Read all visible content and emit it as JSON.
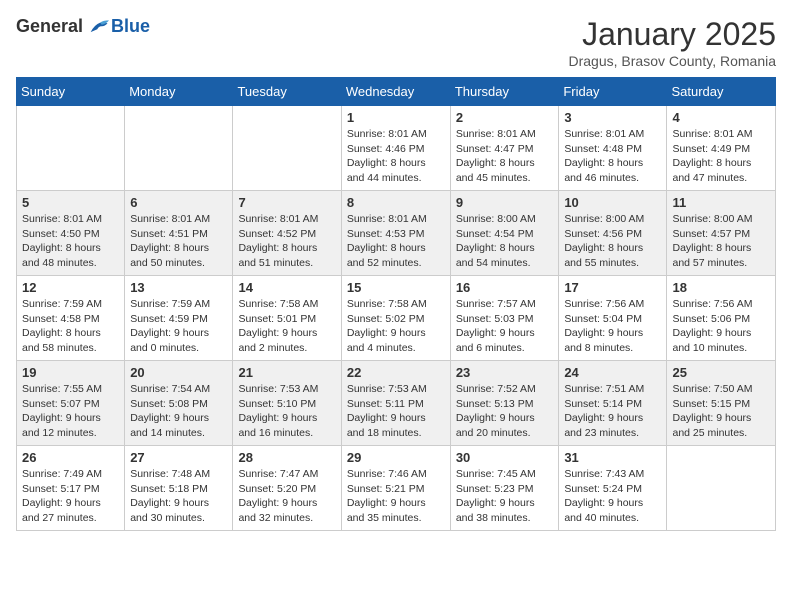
{
  "logo": {
    "general": "General",
    "blue": "Blue"
  },
  "title": {
    "month": "January 2025",
    "location": "Dragus, Brasov County, Romania"
  },
  "weekdays": [
    "Sunday",
    "Monday",
    "Tuesday",
    "Wednesday",
    "Thursday",
    "Friday",
    "Saturday"
  ],
  "weeks": [
    [
      {
        "day": "",
        "info": ""
      },
      {
        "day": "",
        "info": ""
      },
      {
        "day": "",
        "info": ""
      },
      {
        "day": "1",
        "info": "Sunrise: 8:01 AM\nSunset: 4:46 PM\nDaylight: 8 hours\nand 44 minutes."
      },
      {
        "day": "2",
        "info": "Sunrise: 8:01 AM\nSunset: 4:47 PM\nDaylight: 8 hours\nand 45 minutes."
      },
      {
        "day": "3",
        "info": "Sunrise: 8:01 AM\nSunset: 4:48 PM\nDaylight: 8 hours\nand 46 minutes."
      },
      {
        "day": "4",
        "info": "Sunrise: 8:01 AM\nSunset: 4:49 PM\nDaylight: 8 hours\nand 47 minutes."
      }
    ],
    [
      {
        "day": "5",
        "info": "Sunrise: 8:01 AM\nSunset: 4:50 PM\nDaylight: 8 hours\nand 48 minutes."
      },
      {
        "day": "6",
        "info": "Sunrise: 8:01 AM\nSunset: 4:51 PM\nDaylight: 8 hours\nand 50 minutes."
      },
      {
        "day": "7",
        "info": "Sunrise: 8:01 AM\nSunset: 4:52 PM\nDaylight: 8 hours\nand 51 minutes."
      },
      {
        "day": "8",
        "info": "Sunrise: 8:01 AM\nSunset: 4:53 PM\nDaylight: 8 hours\nand 52 minutes."
      },
      {
        "day": "9",
        "info": "Sunrise: 8:00 AM\nSunset: 4:54 PM\nDaylight: 8 hours\nand 54 minutes."
      },
      {
        "day": "10",
        "info": "Sunrise: 8:00 AM\nSunset: 4:56 PM\nDaylight: 8 hours\nand 55 minutes."
      },
      {
        "day": "11",
        "info": "Sunrise: 8:00 AM\nSunset: 4:57 PM\nDaylight: 8 hours\nand 57 minutes."
      }
    ],
    [
      {
        "day": "12",
        "info": "Sunrise: 7:59 AM\nSunset: 4:58 PM\nDaylight: 8 hours\nand 58 minutes."
      },
      {
        "day": "13",
        "info": "Sunrise: 7:59 AM\nSunset: 4:59 PM\nDaylight: 9 hours\nand 0 minutes."
      },
      {
        "day": "14",
        "info": "Sunrise: 7:58 AM\nSunset: 5:01 PM\nDaylight: 9 hours\nand 2 minutes."
      },
      {
        "day": "15",
        "info": "Sunrise: 7:58 AM\nSunset: 5:02 PM\nDaylight: 9 hours\nand 4 minutes."
      },
      {
        "day": "16",
        "info": "Sunrise: 7:57 AM\nSunset: 5:03 PM\nDaylight: 9 hours\nand 6 minutes."
      },
      {
        "day": "17",
        "info": "Sunrise: 7:56 AM\nSunset: 5:04 PM\nDaylight: 9 hours\nand 8 minutes."
      },
      {
        "day": "18",
        "info": "Sunrise: 7:56 AM\nSunset: 5:06 PM\nDaylight: 9 hours\nand 10 minutes."
      }
    ],
    [
      {
        "day": "19",
        "info": "Sunrise: 7:55 AM\nSunset: 5:07 PM\nDaylight: 9 hours\nand 12 minutes."
      },
      {
        "day": "20",
        "info": "Sunrise: 7:54 AM\nSunset: 5:08 PM\nDaylight: 9 hours\nand 14 minutes."
      },
      {
        "day": "21",
        "info": "Sunrise: 7:53 AM\nSunset: 5:10 PM\nDaylight: 9 hours\nand 16 minutes."
      },
      {
        "day": "22",
        "info": "Sunrise: 7:53 AM\nSunset: 5:11 PM\nDaylight: 9 hours\nand 18 minutes."
      },
      {
        "day": "23",
        "info": "Sunrise: 7:52 AM\nSunset: 5:13 PM\nDaylight: 9 hours\nand 20 minutes."
      },
      {
        "day": "24",
        "info": "Sunrise: 7:51 AM\nSunset: 5:14 PM\nDaylight: 9 hours\nand 23 minutes."
      },
      {
        "day": "25",
        "info": "Sunrise: 7:50 AM\nSunset: 5:15 PM\nDaylight: 9 hours\nand 25 minutes."
      }
    ],
    [
      {
        "day": "26",
        "info": "Sunrise: 7:49 AM\nSunset: 5:17 PM\nDaylight: 9 hours\nand 27 minutes."
      },
      {
        "day": "27",
        "info": "Sunrise: 7:48 AM\nSunset: 5:18 PM\nDaylight: 9 hours\nand 30 minutes."
      },
      {
        "day": "28",
        "info": "Sunrise: 7:47 AM\nSunset: 5:20 PM\nDaylight: 9 hours\nand 32 minutes."
      },
      {
        "day": "29",
        "info": "Sunrise: 7:46 AM\nSunset: 5:21 PM\nDaylight: 9 hours\nand 35 minutes."
      },
      {
        "day": "30",
        "info": "Sunrise: 7:45 AM\nSunset: 5:23 PM\nDaylight: 9 hours\nand 38 minutes."
      },
      {
        "day": "31",
        "info": "Sunrise: 7:43 AM\nSunset: 5:24 PM\nDaylight: 9 hours\nand 40 minutes."
      },
      {
        "day": "",
        "info": ""
      }
    ]
  ]
}
